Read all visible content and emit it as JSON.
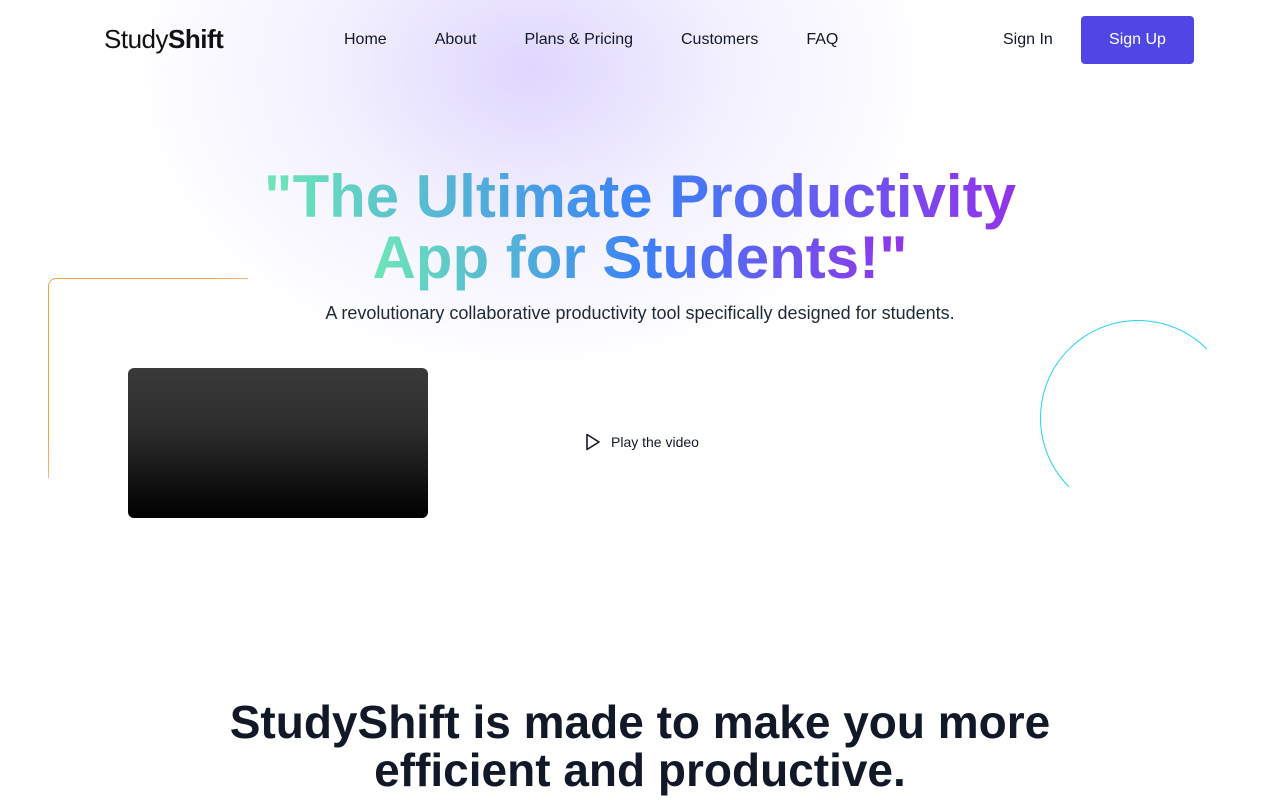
{
  "brand": {
    "part1": "Study",
    "part2": "Shift"
  },
  "nav": {
    "items": [
      "Home",
      "About",
      "Plans & Pricing",
      "Customers",
      "FAQ"
    ]
  },
  "auth": {
    "signin": "Sign In",
    "signup": "Sign Up"
  },
  "hero": {
    "title_line1": "\"The Ultimate Productivity",
    "title_line2": "App for Students!\"",
    "subtitle": "A revolutionary collaborative productivity tool specifically designed for students.",
    "play_label": "Play the video"
  },
  "section": {
    "title_line1": "StudyShift is made to make you more",
    "title_line2": "efficient and productive."
  },
  "colors": {
    "primary": "#4f46e5",
    "gradient_start": "#6ee7b7",
    "gradient_mid": "#3b82f6",
    "gradient_end": "#9333ea",
    "deco_orange": "#f59e42",
    "deco_cyan": "#22d3ee"
  },
  "icons": {
    "play": "play-icon"
  }
}
